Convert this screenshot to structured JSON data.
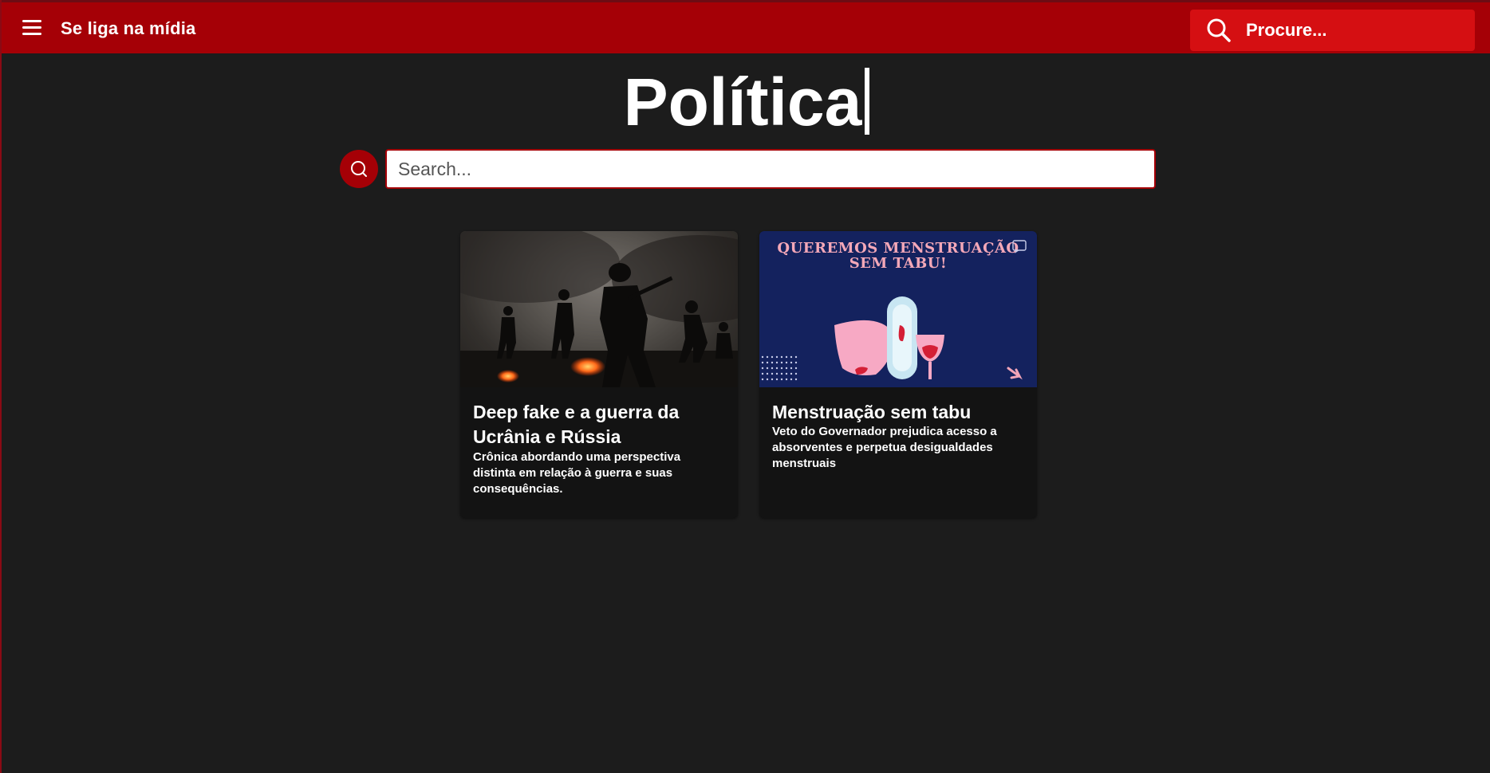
{
  "header": {
    "brand": "Se liga na mídia",
    "search_placeholder": "Procure..."
  },
  "page": {
    "title": "Política"
  },
  "search": {
    "placeholder": "Search..."
  },
  "articles": [
    {
      "title": "Deep fake e a guerra da Ucrânia e Rússia",
      "description": "Crônica abordando uma perspectiva distinta em relação à guerra e suas consequências."
    },
    {
      "title": "Menstruação sem tabu",
      "description": "Veto do Governador prejudica acesso a absorventes e perpetua desigualdades menstruais",
      "image_text": "QUEREMOS MENSTRUAÇÃO SEM TABU!"
    }
  ],
  "colors": {
    "header_bg": "#a50006",
    "header_search_bg": "#d50f12",
    "page_bg": "#1c1c1c",
    "card_bg": "#131313",
    "accent": "#a50006"
  },
  "icons": [
    "menu-icon",
    "search-icon"
  ]
}
